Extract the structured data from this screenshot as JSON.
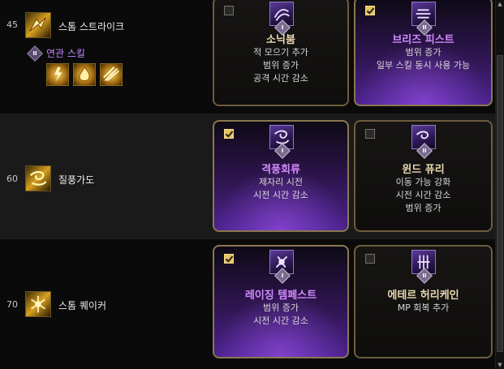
{
  "rows": [
    {
      "level": "45",
      "skill_name": "스톰 스트라이크",
      "icon": "storm-strike-icon",
      "related": {
        "badge": "II",
        "label": "연관 스킬",
        "icons": [
          "lightning-figure-icon",
          "flame-burst-icon",
          "electric-slash-icon"
        ]
      },
      "options": [
        {
          "checked": false,
          "rank": "I",
          "title": "소닉붐",
          "desc": [
            "적 모으기 추가",
            "범위 증가",
            "공격 시간 감소"
          ],
          "icon": "sonic-boom-icon"
        },
        {
          "checked": true,
          "rank": "II",
          "title": "브리즈 피스트",
          "desc": [
            "범위 증가",
            "일부 스킬 동시 사용 가능"
          ],
          "icon": "breeze-fist-icon"
        }
      ]
    },
    {
      "level": "60",
      "skill_name": "질풍가도",
      "icon": "gale-road-icon",
      "options": [
        {
          "checked": true,
          "rank": "I",
          "title": "격풍회류",
          "desc": [
            "제자리 시전",
            "시전 시간 감소"
          ],
          "icon": "gale-whirl-icon"
        },
        {
          "checked": false,
          "rank": "II",
          "title": "윈드 퓨리",
          "desc": [
            "이동 가능 강화",
            "시전 시간 감소",
            "범위 증가"
          ],
          "icon": "wind-fury-icon"
        }
      ]
    },
    {
      "level": "70",
      "skill_name": "스톰 퀘이커",
      "icon": "storm-quaker-icon",
      "options": [
        {
          "checked": true,
          "rank": "I",
          "title": "레이징 템페스트",
          "desc": [
            "범위 증가",
            "시전 시간 감소"
          ],
          "icon": "raging-tempest-icon"
        },
        {
          "checked": false,
          "rank": "II",
          "title": "에테르 허리케인",
          "desc": [
            "MP 회복 추가"
          ],
          "icon": "ether-hurricane-icon"
        }
      ]
    }
  ],
  "colors": {
    "selected_title": "#d38aff",
    "title": "#e8d9b0",
    "related_label": "#c089ff",
    "card_border": "#6d5d3c"
  }
}
